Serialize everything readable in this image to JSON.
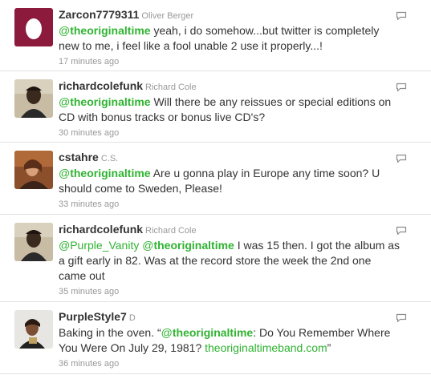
{
  "tweets": [
    {
      "screen_name": "Zarcon7779311",
      "full_name": "Oliver Berger",
      "parts": [
        {
          "type": "mention-plain",
          "at": "@",
          "name": "theoriginaltime"
        },
        {
          "type": "text",
          "value": " yeah, i do somehow...but twitter is completely new to me, i feel like a fool unable 2 use it properly...!"
        }
      ],
      "time": "17 minutes ago",
      "avatar": "egg"
    },
    {
      "screen_name": "richardcolefunk",
      "full_name": "Richard Cole",
      "parts": [
        {
          "type": "mention-plain",
          "at": "@",
          "name": "theoriginaltime"
        },
        {
          "type": "text",
          "value": " Will there be any reissues or special editions on CD with bonus tracks or bonus live CD's?"
        }
      ],
      "time": "30 minutes ago",
      "avatar": "photo-dark"
    },
    {
      "screen_name": "cstahre",
      "full_name": "C.S.",
      "parts": [
        {
          "type": "mention-plain",
          "at": "@",
          "name": "theoriginaltime"
        },
        {
          "type": "text",
          "value": " Are u gonna play in Europe any time soon? U should come to Sweden, Please!"
        }
      ],
      "time": "33 minutes ago",
      "avatar": "photo-warm"
    },
    {
      "screen_name": "richardcolefunk",
      "full_name": "Richard Cole",
      "parts": [
        {
          "type": "mention-plain",
          "at": "@",
          "name": "Purple_Vanity"
        },
        {
          "type": "text",
          "value": " "
        },
        {
          "type": "mention-plain",
          "at": "@",
          "name": "theoriginaltime"
        },
        {
          "type": "text",
          "value": " I was 15 then. I got the album as a gift early in 82. Was at the record store the week the 2nd one came out"
        }
      ],
      "time": "35 minutes ago",
      "avatar": "photo-dark"
    },
    {
      "screen_name": "PurpleStyle7",
      "full_name": "D",
      "parts": [
        {
          "type": "text",
          "value": "Baking in the oven. “"
        },
        {
          "type": "mention-plain",
          "at": "@",
          "name": "theoriginaltime"
        },
        {
          "type": "text",
          "value": ": Do You Remember Where You Were On July 29, 1981? "
        },
        {
          "type": "link",
          "value": "theoriginaltimeband.com"
        },
        {
          "type": "text",
          "value": "”"
        }
      ],
      "time": "36 minutes ago",
      "avatar": "photo-light"
    }
  ],
  "colors": {
    "link": "#2fb331",
    "text": "#333333",
    "meta": "#999999",
    "divider": "#e2e2e2",
    "egg_bg": "#8b1a3c"
  },
  "icons": {
    "reply": "speech-bubble-icon",
    "avatar_default": "egg-avatar-icon"
  }
}
